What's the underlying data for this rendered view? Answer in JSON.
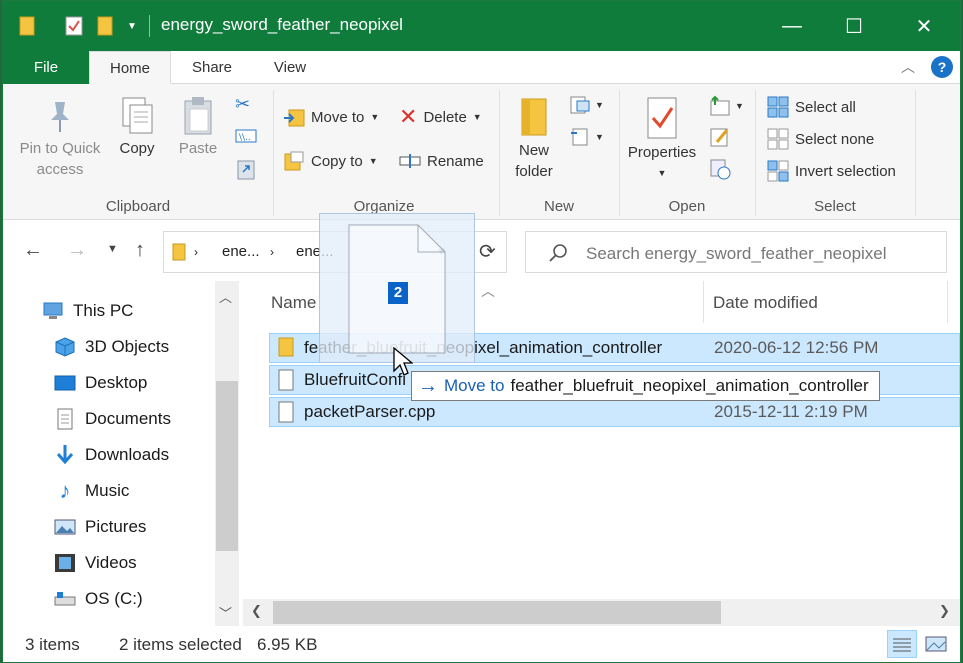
{
  "window": {
    "title": "energy_sword_feather_neopixel",
    "controls": {
      "minimize": "—",
      "maximize": "☐",
      "close": "✕"
    }
  },
  "tabs": {
    "file": "File",
    "home": "Home",
    "share": "Share",
    "view": "View"
  },
  "ribbon": {
    "clipboard": {
      "label": "Clipboard",
      "pin_line1": "Pin to Quick",
      "pin_line2": "access",
      "copy": "Copy",
      "paste": "Paste"
    },
    "organize": {
      "label": "Organize",
      "move_to": "Move to",
      "copy_to": "Copy to",
      "delete": "Delete",
      "rename": "Rename"
    },
    "new": {
      "label": "New",
      "new_folder_line1": "New",
      "new_folder_line2": "folder"
    },
    "open": {
      "label": "Open",
      "properties": "Properties"
    },
    "select": {
      "label": "Select",
      "select_all": "Select all",
      "select_none": "Select none",
      "invert": "Invert selection"
    }
  },
  "address": {
    "crumb1": "ene...",
    "crumb2": "ene...",
    "search_placeholder": "Search energy_sword_feather_neopixel"
  },
  "nav": {
    "items": [
      {
        "label": "This PC",
        "icon": "computer-icon"
      },
      {
        "label": "3D Objects",
        "icon": "cube-icon"
      },
      {
        "label": "Desktop",
        "icon": "desktop-icon"
      },
      {
        "label": "Documents",
        "icon": "documents-icon"
      },
      {
        "label": "Downloads",
        "icon": "download-icon"
      },
      {
        "label": "Music",
        "icon": "music-icon"
      },
      {
        "label": "Pictures",
        "icon": "pictures-icon"
      },
      {
        "label": "Videos",
        "icon": "videos-icon"
      },
      {
        "label": "OS (C:)",
        "icon": "drive-icon"
      }
    ]
  },
  "filelist": {
    "col_name": "Name",
    "col_date": "Date modified",
    "rows": [
      {
        "name": "feather_bluefruit_neopixel_animation_controller",
        "date": "2020-06-12 12:56 PM",
        "type": "folder",
        "selected": true
      },
      {
        "name": "BluefruitConfi",
        "date": "",
        "type": "file",
        "selected": true
      },
      {
        "name": "packetParser.cpp",
        "date": "2015-12-11 2:19 PM",
        "type": "file",
        "selected": true
      }
    ]
  },
  "drag": {
    "count": "2",
    "verb": "Move to",
    "target": "feather_bluefruit_neopixel_animation_controller"
  },
  "status": {
    "items": "3 items",
    "selected": "2 items selected",
    "size": "6.95 KB"
  },
  "colors": {
    "accent": "#107c3c",
    "selection": "#cce8ff",
    "link": "#1a5fb4"
  }
}
